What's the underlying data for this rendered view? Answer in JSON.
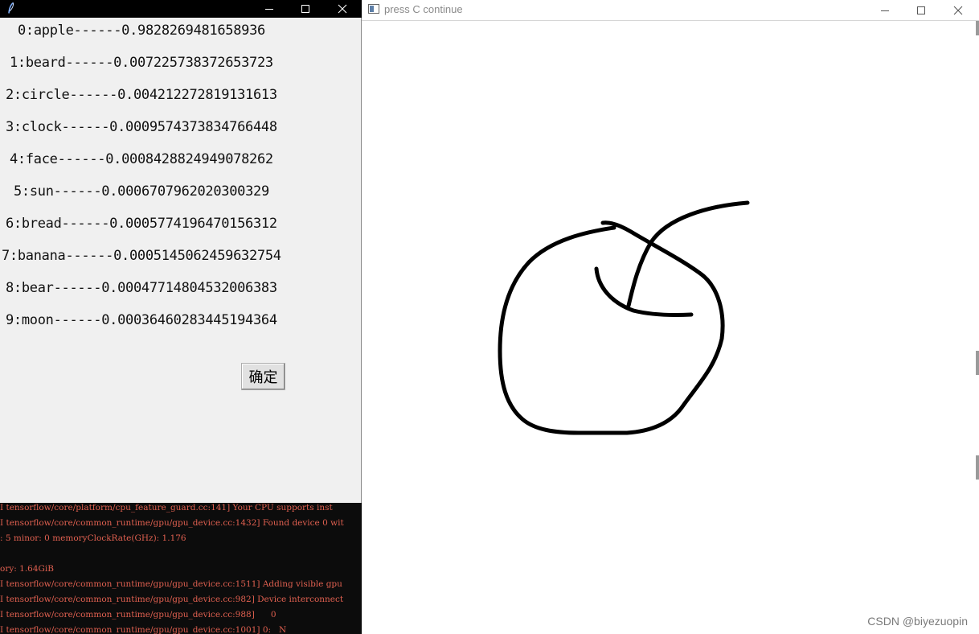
{
  "tk_window": {
    "predictions": [
      {
        "text": "0:apple------0.9828269481658936"
      },
      {
        "text": "1:beard------0.007225738372653723"
      },
      {
        "text": "2:circle------0.004212272819131613"
      },
      {
        "text": "3:clock------0.0009574373834766448"
      },
      {
        "text": "4:face------0.0008428824949078262"
      },
      {
        "text": "5:sun------0.0006707962020300329"
      },
      {
        "text": "6:bread------0.0005774196470156312"
      },
      {
        "text": "7:banana------0.0005145062459632754"
      },
      {
        "text": "8:bear------0.00047714804532006383"
      },
      {
        "text": "9:moon------0.00036460283445194364"
      }
    ],
    "ok_button_label": "确定"
  },
  "console": {
    "lines": [
      "I tensorflow/core/platform/cpu_feature_guard.cc:141] Your CPU supports inst",
      "I tensorflow/core/common_runtime/gpu/gpu_device.cc:1432] Found device 0 wit",
      ": 5 minor: 0 memoryClockRate(GHz): 1.176",
      "",
      "ory: 1.64GiB",
      "I tensorflow/core/common_runtime/gpu/gpu_device.cc:1511] Adding visible gpu",
      "I tensorflow/core/common_runtime/gpu/gpu_device.cc:982] Device interconnect",
      "I tensorflow/core/common_runtime/gpu/gpu_device.cc:988]      0",
      "I tensorflow/core/common_runtime/gpu/gpu_device.cc:1001] 0:   N"
    ]
  },
  "draw_window": {
    "title": "press C continue",
    "watermark": "CSDN @biyezuopin"
  },
  "colors": {
    "tk_background": "#f0f0f0",
    "console_background": "#0c0c0c",
    "console_text": "#e06050",
    "ink": "#000000"
  }
}
